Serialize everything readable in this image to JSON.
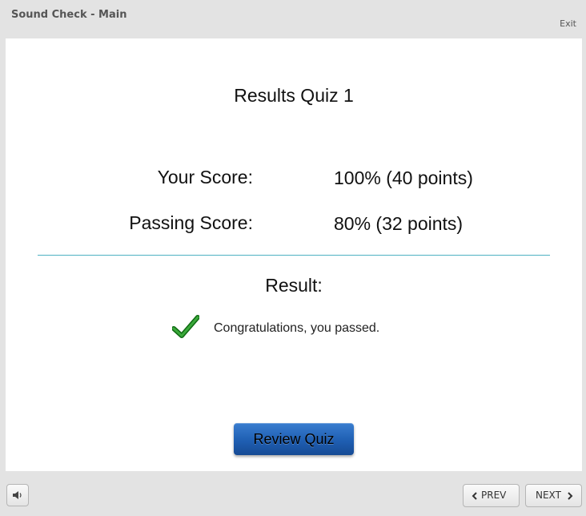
{
  "header": {
    "app_title": "Sound Check - Main",
    "exit_label": "Exit"
  },
  "slide": {
    "title": "Results Quiz 1",
    "your_score_label": "Your Score:",
    "your_score_value": "100% (40 points)",
    "passing_score_label": "Passing Score:",
    "passing_score_value": "80% (32 points)",
    "result_label": "Result:",
    "result_message": "Congratulations, you passed.",
    "review_button_label": "Review Quiz"
  },
  "footer": {
    "audio_icon": "speaker-icon",
    "prev_label": "PREV",
    "next_label": "NEXT"
  },
  "colors": {
    "divider": "#4eb1c2",
    "check": "#1e8a1e",
    "button": "#1f5fb2"
  }
}
